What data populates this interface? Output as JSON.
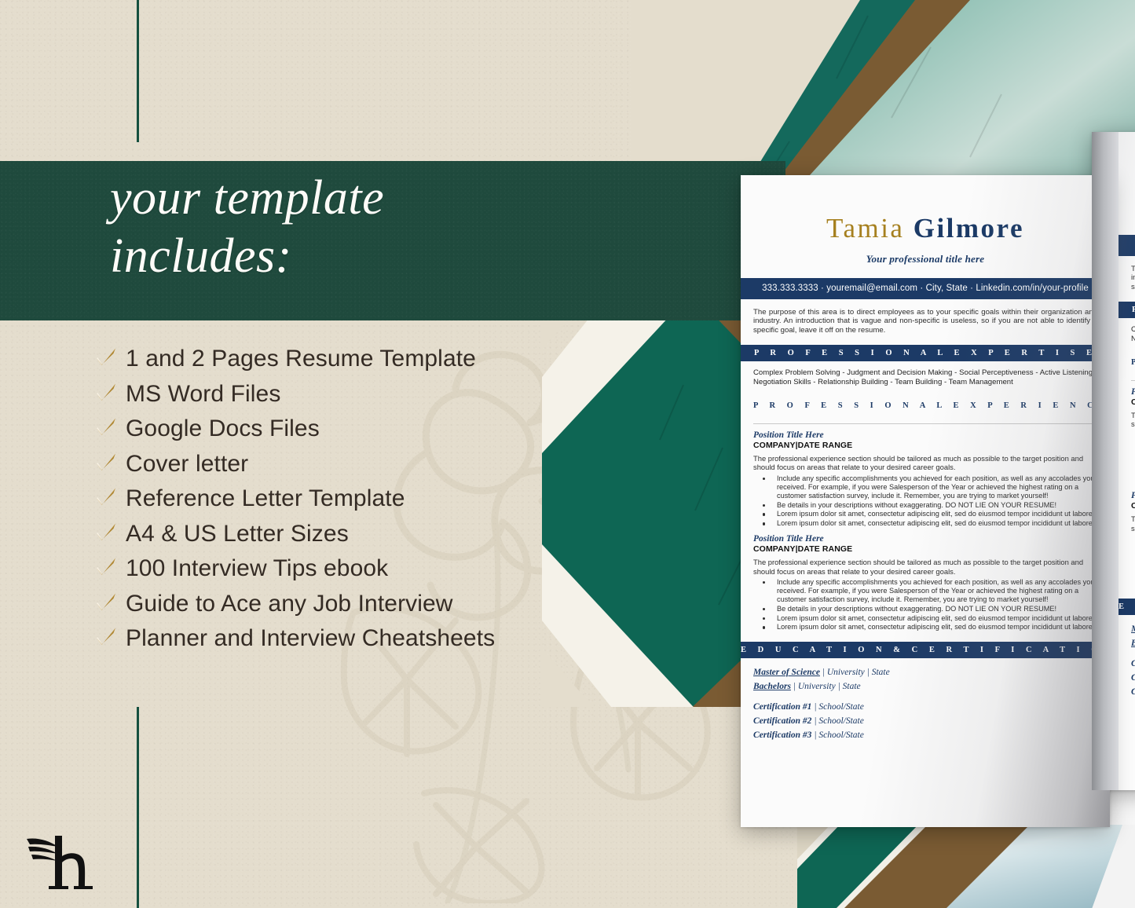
{
  "banner": {
    "title": "your template\nincludes:"
  },
  "checklist": {
    "items": [
      "1 and 2 Pages Resume Template",
      "MS Word Files",
      "Google Docs Files",
      "Cover letter",
      "Reference Letter Template",
      "A4 & US Letter Sizes",
      "100 Interview Tips ebook",
      "Guide to Ace any Job Interview",
      "Planner and Interview Cheatsheets"
    ]
  },
  "logo": {
    "letter": "h",
    "name": "winged-h-logo"
  },
  "colors": {
    "green": "#1f4a3d",
    "cream": "#e4ddcd",
    "gold": "#c49a3f",
    "navy": "#1c3a66",
    "brown": "#7a5b33",
    "text_dark": "#342b24"
  },
  "resume": {
    "first_name": "Tamia",
    "last_name": "Gilmore",
    "subtitle": "Your professional title here",
    "contact": "333.333.3333 · youremail@email.com · City, State · Linkedin.com/in/your-profile",
    "summary": "The purpose of this area is to direct employees as to your specific goals within their organization and industry. An introduction that is vague and non-specific is useless, so if you are not able to identify a specific goal, leave it off on the resume.",
    "sections": {
      "expertise": "P R O F E S S I O N A L   E X P E R T I S E",
      "experience": "P R O F E S S I O N A L   E X P E R I E N C E",
      "education": "E D U C A T I O N   &   C E R T I F I C A T I O N S"
    },
    "skills": "Complex Problem Solving - Judgment and Decision Making - Social Perceptiveness - Active Listening - Negotiation Skills - Relationship Building - Team Building - Team Management",
    "jobs": [
      {
        "title": "Position Title Here",
        "company": "COMPANY|DATE RANGE",
        "desc": "The professional experience section should be tailored as much as possible to the target position and should focus on areas that relate to your desired career goals.",
        "bullets": [
          "Include any specific accomplishments you achieved for each position, as well as any accolades you received. For example, if you were Salesperson of the Year or achieved the highest rating on a customer satisfaction survey, include it.  Remember, you are trying to market yourself!",
          "Be details in your descriptions without exaggerating.  DO NOT LIE ON YOUR RESUME!",
          "Lorem ipsum dolor sit amet, consectetur adipiscing elit, sed do eiusmod tempor incididunt ut labore",
          "Lorem ipsum dolor sit amet, consectetur adipiscing elit, sed do eiusmod tempor incididunt ut labore"
        ]
      },
      {
        "title": "Position Title Here",
        "company": "COMPANY|DATE RANGE",
        "desc": "The professional experience section should be tailored as much as possible to the target position and should focus on areas that relate to your desired career goals.",
        "bullets": [
          "Include any specific accomplishments you achieved for each position, as well as any accolades you received. For example, if you were Salesperson of the Year or achieved the highest rating on a customer satisfaction survey, include it.  Remember, you are trying to market yourself!",
          "Be details in your descriptions without exaggerating.  DO NOT LIE ON YOUR RESUME!",
          "Lorem ipsum dolor sit amet, consectetur adipiscing elit, sed do eiusmod tempor incididunt ut labore",
          "Lorem ipsum dolor sit amet, consectetur adipiscing elit, sed do eiusmod tempor incididunt ut labore"
        ]
      }
    ],
    "education": [
      {
        "degree": "Master of Science",
        "rest": " |  University  |  State"
      },
      {
        "degree": "Bachelors",
        "rest": " |  University  |  State"
      }
    ],
    "certifications": [
      {
        "degree": "Certification #1",
        "rest": " |  School/State"
      },
      {
        "degree": "Certification #2",
        "rest": " |  School/State"
      },
      {
        "degree": "Certification #3",
        "rest": " |  School/State"
      }
    ]
  }
}
